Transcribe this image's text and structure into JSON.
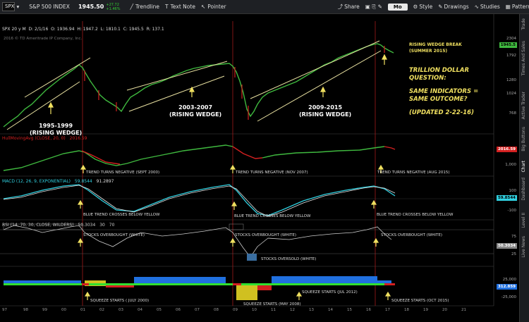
{
  "toolbar": {
    "symbol": "SPX",
    "symbol_name": "S&P 500 INDEX",
    "price": "1945.50",
    "change": "+27.72",
    "change_pct": "+1.46%",
    "trendline_label": "Trendline",
    "textnote_label": "Text Note",
    "pointer_label": "Pointer",
    "share_label": "Share",
    "timeframe_label": "Mo",
    "style_label": "Style",
    "drawings_label": "Drawings",
    "studies_label": "Studies",
    "patterns_label": "Patterns"
  },
  "chart_header": {
    "period": "SPX 20 y M",
    "date": "D: 2/1/16",
    "open": "O: 1936.94",
    "high": "H: 1947.2",
    "low": "L: 1810.1",
    "close": "C: 1945.5",
    "range": "R: 137.1",
    "copyright": "2016 © TD Ameritrade IP Company, Inc."
  },
  "price_axis": [
    "2304",
    "1792",
    "1280",
    "1024",
    "768"
  ],
  "current_price_badge": "1945.5",
  "annotations": {
    "rising_wedge_break_1": "RISING WEDGE BREAK",
    "rising_wedge_break_2": "(SUMMER 2015)",
    "question": [
      "TRILLION DOLLAR",
      "QUESTION:",
      "",
      "SAME INDICATORS =",
      "SAME OUTCOME?",
      "",
      "(UPDATED 2-22-16)"
    ],
    "wedge_1999_a": "1995-1999",
    "wedge_1999_b": "(RISING WEDGE)",
    "wedge_2007_a": "2003-2007",
    "wedge_2007_b": "(RISING WEDGE)",
    "wedge_2015_a": "2009-2015",
    "wedge_2015_b": "(RISING WEDGE)"
  },
  "hull": {
    "label": "HullMovingAvg (CLOSE, 20, 0)",
    "value": "2016.59",
    "axis": "1,000",
    "notes": [
      "TREND TURNS NEGATIVE (SEPT 2000)",
      "TREND TURNS NEGATIVE (NOV 2007)",
      "TREND TURNS NEGATIVE (AUG 2015)"
    ]
  },
  "macd": {
    "label": "MACD (12, 26, 9, EXPONENTIAL)",
    "value1": "59.8544",
    "value2": "91.2897",
    "axis_top": "100",
    "axis_bottom": "-100",
    "notes": [
      "BLUE TREND CROSSES BELOW YELLOW",
      "BLUE TREND CROSSES BELOW YELLOW",
      "BLUE TREND CROSSES BELOW YELLOW"
    ]
  },
  "rsi": {
    "label": "RSI (14, 70, 30, CLOSE, WILDERS)",
    "value": "50.3034",
    "ob": "30",
    "os": "70",
    "axis_75": "75",
    "axis_25": "25",
    "notes": [
      "STOCKS OVERBOUGHT (WHITE)",
      "STOCKS OVERBOUGHT (WHITE)",
      "STOCKS OVERBOUGHT (WHITE)",
      "STOCKS OVERSOLD (WHITE)"
    ]
  },
  "ttm": {
    "axis_top": "25,000",
    "axis_bottom": "-25,000",
    "value": "312.859",
    "notes": [
      "SQUEEZE STARTS ( JULY 2000)",
      "SQUEEZE STARTS (MAY 2008)",
      "SQUEEZE STARTS (JUL 2012)",
      "SQUEEZE STARTS (OCT 2015)"
    ]
  },
  "x_axis": [
    "97",
    "98",
    "99",
    "00",
    "01",
    "02",
    "03",
    "04",
    "05",
    "06",
    "07",
    "08",
    "09",
    "10",
    "11",
    "12",
    "13",
    "14",
    "15",
    "16",
    "17",
    "18",
    "19",
    "20",
    "21"
  ],
  "sidebar_tabs": [
    "Trade",
    "Times And Sales",
    "Active Trader",
    "Big Buttons",
    "Chart",
    "Dashboard",
    "Level II",
    "Live News"
  ],
  "colors": {
    "green": "#3fb93f",
    "red": "#d32020",
    "gold": "#f0e060",
    "cyan": "#30d0e0"
  }
}
